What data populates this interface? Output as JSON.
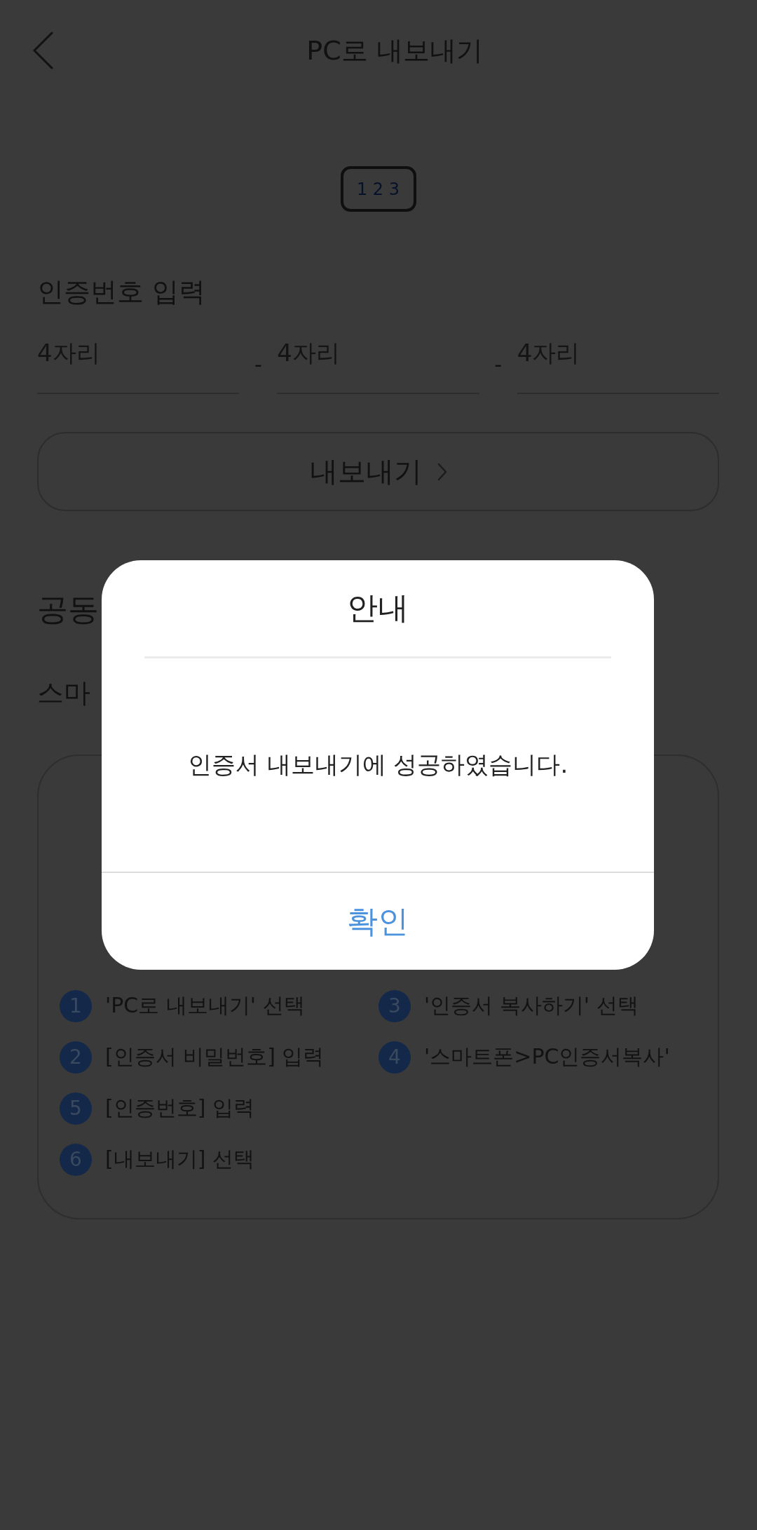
{
  "header": {
    "title": "PC로 내보내기"
  },
  "number_tag": {
    "label": "1 2 3"
  },
  "code_entry": {
    "label": "인증번호 입력",
    "fields": [
      {
        "placeholder": "4자리"
      },
      {
        "placeholder": "4자리"
      },
      {
        "placeholder": "4자리"
      }
    ],
    "separators": [
      "-",
      "-"
    ]
  },
  "export_button": {
    "label": "내보내기"
  },
  "section": {
    "title": "공동",
    "subtitle": "스마"
  },
  "guide_card": {
    "columns": [
      {
        "steps": [
          {
            "number": "1",
            "text": "'PC로 내보내기' 선택"
          },
          {
            "number": "2",
            "text": "[인증서 비밀번호] 입력"
          },
          {
            "number": "5",
            "text": "[인증번호] 입력"
          },
          {
            "number": "6",
            "text": "[내보내기] 선택"
          }
        ]
      },
      {
        "steps": [
          {
            "number": "3",
            "text": "'인증서 복사하기' 선택"
          },
          {
            "number": "4",
            "text": "'스마트폰>PC인증서복사'"
          }
        ]
      }
    ]
  },
  "dialog": {
    "title": "안내",
    "message": "인증서 내보내기에 성공하였습니다.",
    "button": "확인"
  }
}
